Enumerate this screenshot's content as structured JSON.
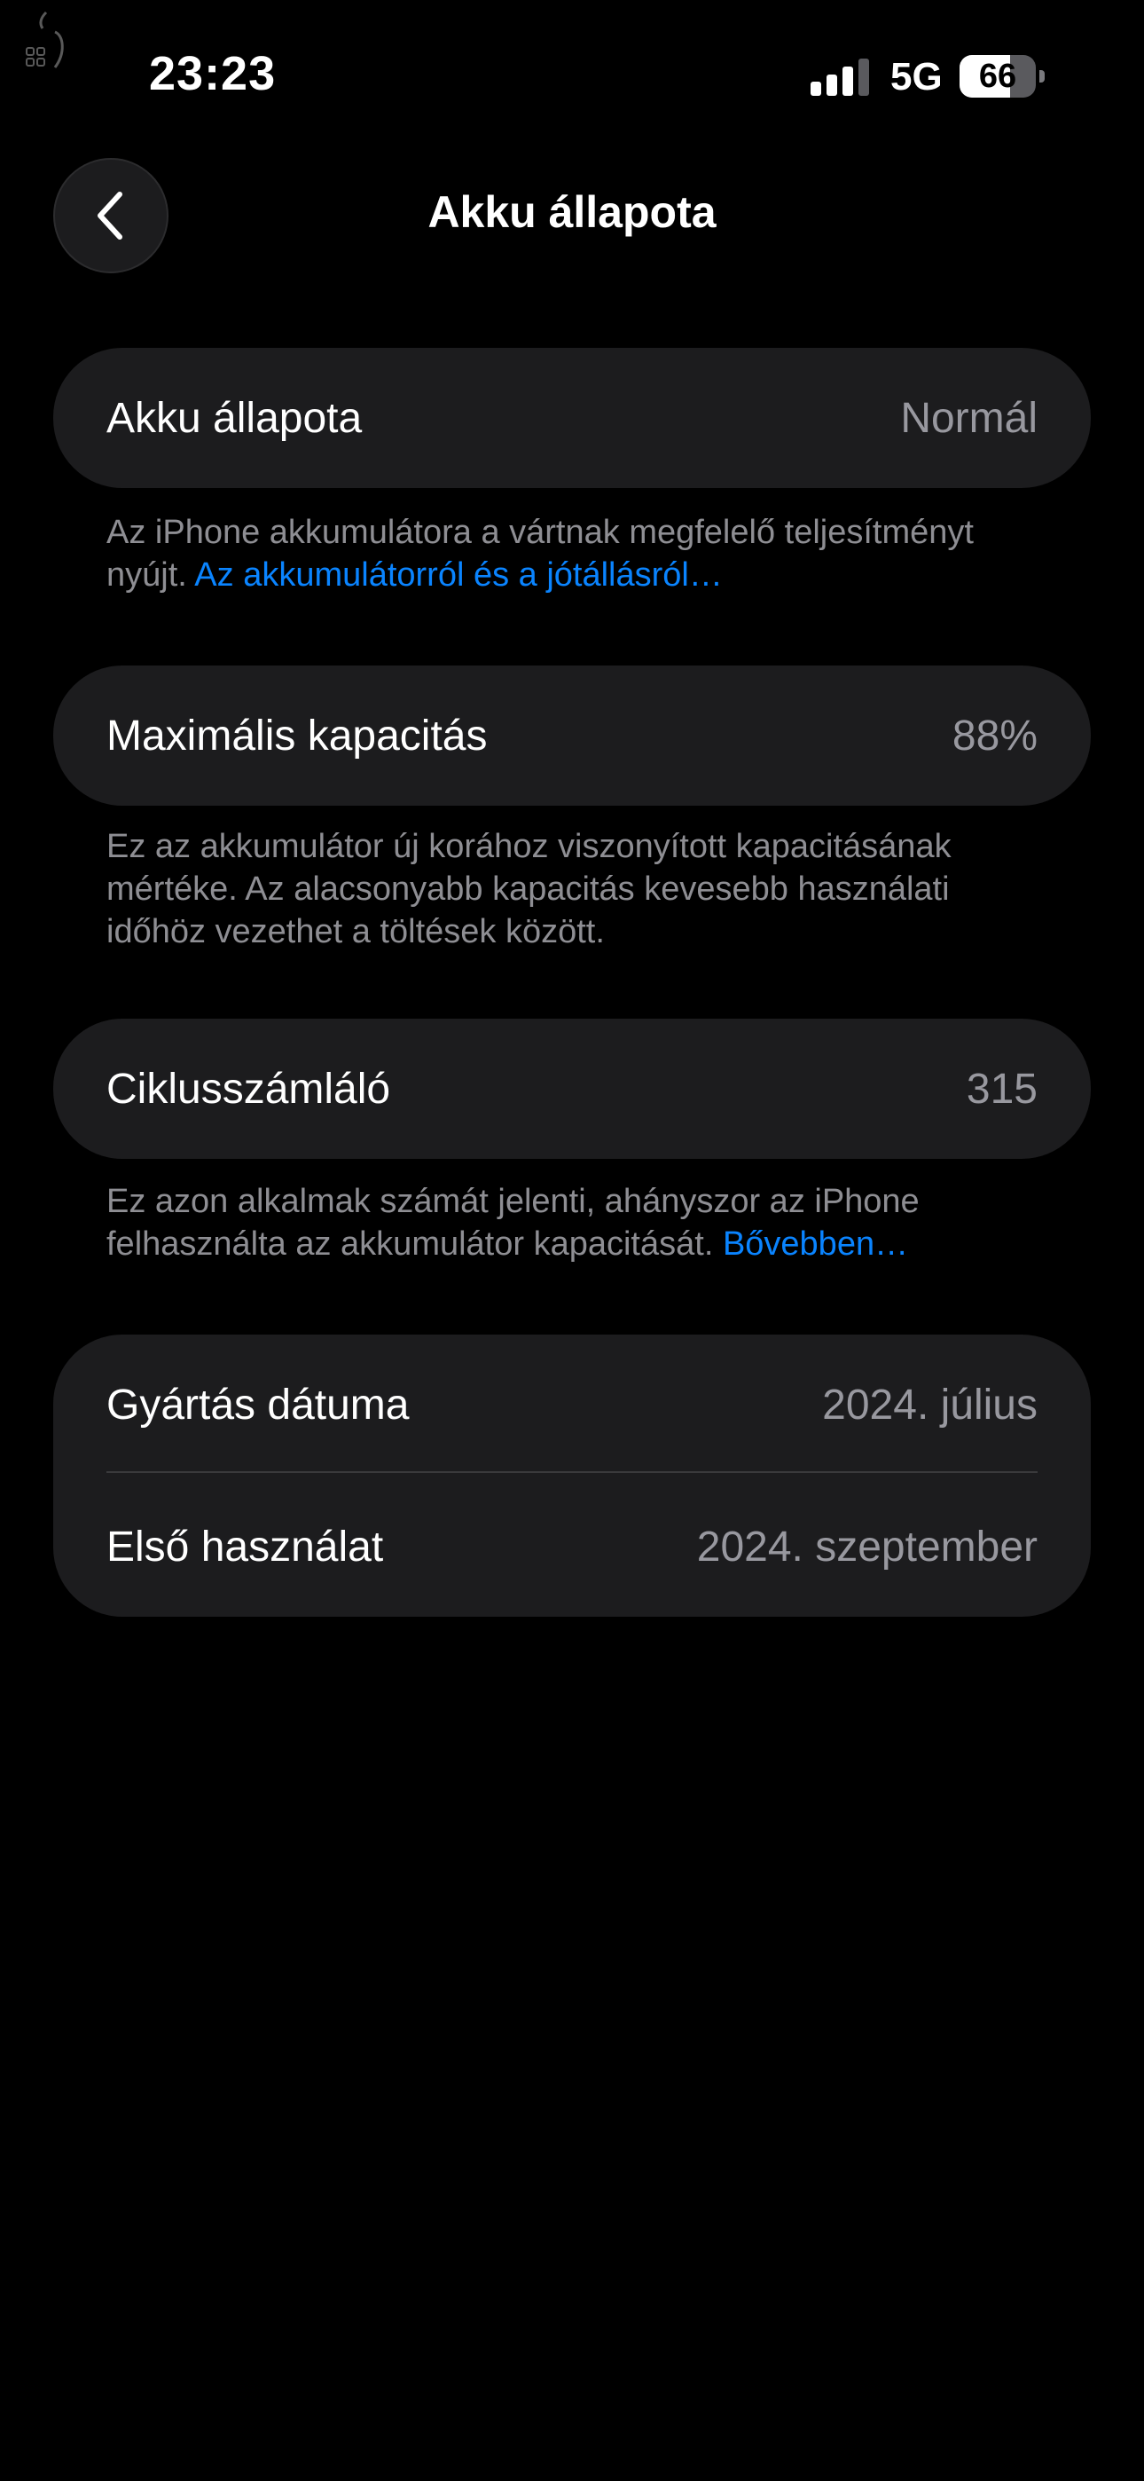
{
  "status_bar": {
    "time": "23:23",
    "network": "5G",
    "battery_percent": "66",
    "battery_level": 0.66,
    "signal_bars_active": 3,
    "signal_bars_total": 4
  },
  "header": {
    "title": "Akku állapota",
    "back_icon": "chevron-left-icon"
  },
  "battery_health": {
    "label": "Akku állapota",
    "value": "Normál",
    "note": "Az iPhone akkumulátora a vártnak megfelelő teljesítményt nyújt.",
    "link": "Az akkumulátorról és a jótállásról…"
  },
  "max_capacity": {
    "label": "Maximális kapacitás",
    "value": "88%",
    "note": "Ez az akkumulátor új korához viszonyított kapacitásának mértéke. Az alacsonyabb kapacitás kevesebb használati időhöz vezethet a töltések között."
  },
  "cycle_count": {
    "label": "Ciklusszámláló",
    "value": "315",
    "note": "Ez azon alkalmak számát jelenti, ahányszor az iPhone felhasználta az akkumulátor kapacitását.",
    "link": "Bővebben…"
  },
  "dates": {
    "manufacture_label": "Gyártás dátuma",
    "manufacture_value": "2024. július",
    "first_use_label": "Első használat",
    "first_use_value": "2024. szeptember"
  },
  "colors": {
    "background": "#000000",
    "card": "#1c1c1e",
    "secondary_text": "#98989f",
    "link": "#0a84ff"
  }
}
